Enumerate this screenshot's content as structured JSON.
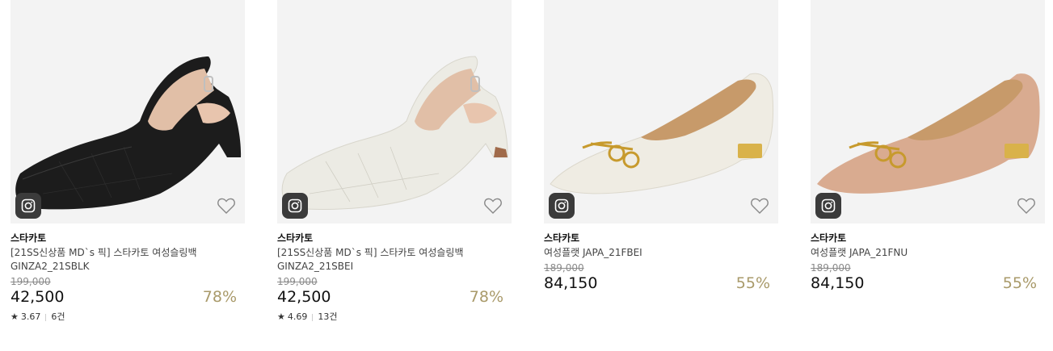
{
  "products": [
    {
      "brand": "스타카토",
      "name_line1": "[21SS신상품 MD`s 픽] 스타카토 여성슬링백",
      "name_line2": "GINZA2_21SBLK",
      "original_price": "199,000",
      "price": "42,500",
      "discount": "78%",
      "rating_star": "★",
      "rating": "3.67",
      "reviews": "6건",
      "shoe_color": "#1c1c1c",
      "shoe_style": "slingback"
    },
    {
      "brand": "스타카토",
      "name_line1": "[21SS신상품 MD`s 픽] 스타카토 여성슬링백",
      "name_line2": "GINZA2_21SBEI",
      "original_price": "199,000",
      "price": "42,500",
      "discount": "78%",
      "rating_star": "★",
      "rating": "4.69",
      "reviews": "13건",
      "shoe_color": "#ecebe4",
      "shoe_style": "slingback"
    },
    {
      "brand": "스타카토",
      "name_line1": "여성플랫 JAPA_21FBEI",
      "name_line2": "",
      "original_price": "189,000",
      "price": "84,150",
      "discount": "55%",
      "shoe_color": "#efece3",
      "shoe_style": "flat"
    },
    {
      "brand": "스타카토",
      "name_line1": "여성플랫 JAPA_21FNU",
      "name_line2": "",
      "original_price": "189,000",
      "price": "84,150",
      "discount": "55%",
      "shoe_color": "#d9ab90",
      "shoe_style": "flat"
    }
  ],
  "icons": {
    "badge": "instagram-icon",
    "wishlist": "heart-outline-icon"
  },
  "colors": {
    "discount": "#a99a6a",
    "thumb_bg": "#f3f3f3",
    "insta_badge": "#3b3b3b"
  }
}
